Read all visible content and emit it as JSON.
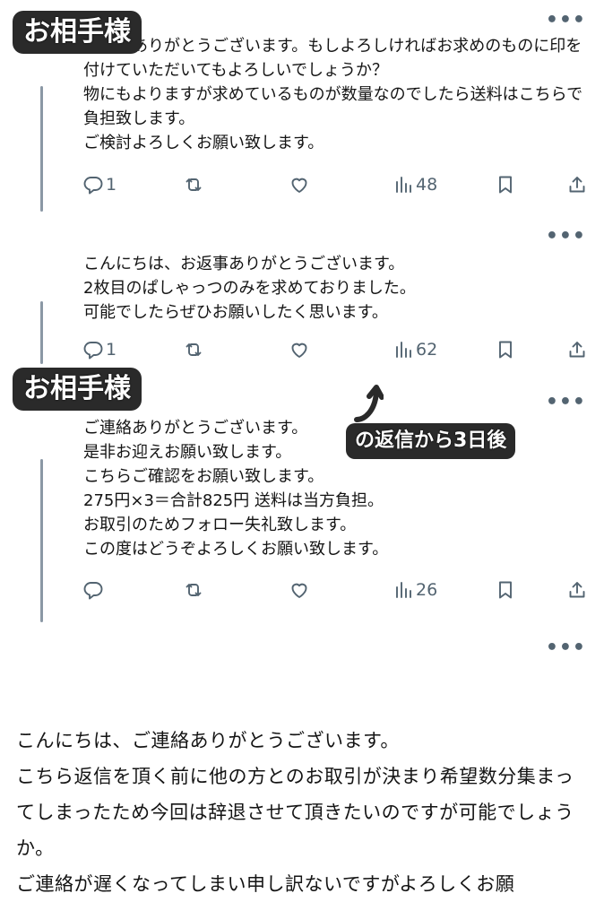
{
  "labels": {
    "partner_badge": "お相手様",
    "later_note": "の返信から3日後"
  },
  "posts": [
    {
      "text": "ご連絡ありがとうございます。もしよろしければお求めのものに印を付けていただいてもよろしいでしょうか？\n物にもよりますが求めているものが数量なのでしたら送料はこちらで負担致します。\nご検討よろしくお願い致します。",
      "reply_count": "1",
      "view_count": "48"
    },
    {
      "text": "こんにちは、お返事ありがとうございます。\n2枚目のぱしゃっつのみを求めておりました。\n可能でしたらぜひお願いしたく思います。",
      "reply_count": "1",
      "view_count": "62"
    },
    {
      "text": "ご連絡ありがとうございます。\n是非お迎えお願い致します。\nこちらご確認をお願い致します。\n275円×3＝合計825円 送料は当方負担。\nお取引のためフォロー失礼致します。\nこの度はどうぞよろしくお願い致します。",
      "reply_count": "",
      "view_count": "26"
    }
  ],
  "last_post": {
    "text": "こんにちは、ご連絡ありがとうございます。\nこちら返信を頂く前に他の方とのお取引が決まり希望数分集まってしまったため今回は辞退させて頂きたいのですが可能でしょうか。\nご連絡が遅くなってしまい申し訳ないですがよろしくお願"
  },
  "icons": [
    "reply-icon",
    "retweet-icon",
    "like-icon",
    "views-icon",
    "bookmark-icon",
    "share-icon",
    "more-icon"
  ],
  "colors": {
    "icon_gray": "#536471",
    "badge_bg": "#2a2a2a",
    "text": "#141414"
  }
}
